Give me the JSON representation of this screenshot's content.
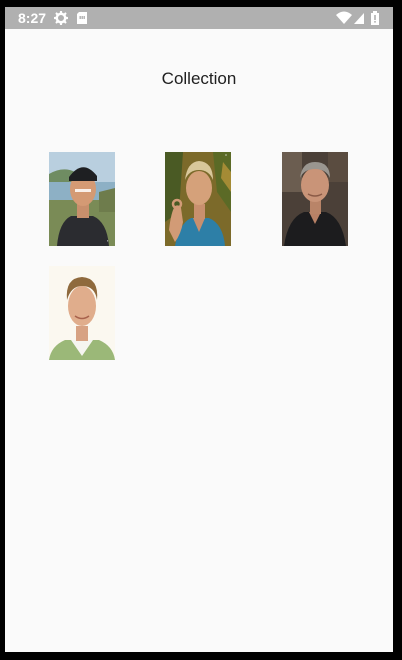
{
  "status_bar": {
    "time": "8:27",
    "icons": [
      "settings-gear-icon",
      "sim-card-icon",
      "wifi-icon",
      "signal-icon",
      "battery-icon"
    ]
  },
  "screen": {
    "title": "Collection"
  },
  "collection": {
    "items": [
      {
        "name": "photo-1",
        "description": "portrait-with-cap-coastal-background"
      },
      {
        "name": "photo-2",
        "description": "portrait-ok-gesture-blue-shirt"
      },
      {
        "name": "photo-3",
        "description": "portrait-gray-hair-dark-shirt"
      },
      {
        "name": "photo-4",
        "description": "portrait-green-sweater-white-background"
      }
    ]
  },
  "colors": {
    "status_bar_bg": "#b0b0b0",
    "screen_bg": "#fafafa",
    "title_text": "#202020"
  }
}
